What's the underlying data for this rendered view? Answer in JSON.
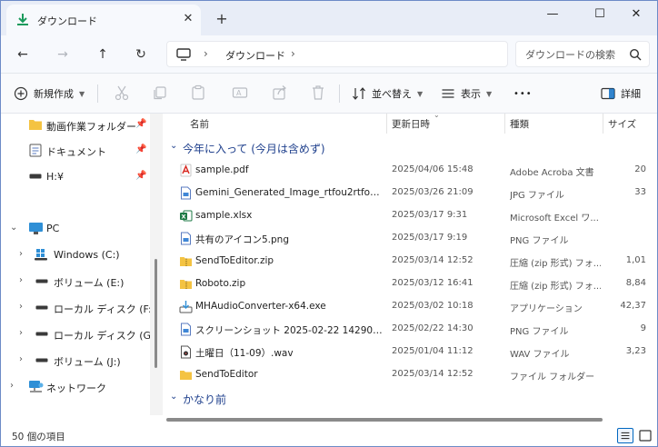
{
  "tab": {
    "title": "ダウンロード",
    "close": "✕",
    "new": "+"
  },
  "window_controls": {
    "minimize": "—",
    "maximize": "☐",
    "close": "✕"
  },
  "nav": {
    "back": "←",
    "forward": "→",
    "up": "↑",
    "refresh": "↻"
  },
  "address": {
    "crumb": "ダウンロード",
    "chevron": "›"
  },
  "search": {
    "placeholder": "ダウンロードの検索"
  },
  "commands": {
    "new_label": "新規作成",
    "sort_label": "並べ替え",
    "view_label": "表示",
    "more_label": "•••",
    "details_label": "詳細"
  },
  "sidebar": {
    "items": [
      {
        "label": "動画作業フォルダー",
        "icon": "folder-icon"
      },
      {
        "label": "ドキュメント",
        "icon": "document-icon"
      },
      {
        "label": "H:¥",
        "icon": "drive-icon"
      },
      {
        "label": "PC",
        "icon": "pc-icon"
      },
      {
        "label": "Windows (C:)",
        "icon": "windows-drive-icon"
      },
      {
        "label": "ボリューム (E:)",
        "icon": "drive-icon"
      },
      {
        "label": "ローカル ディスク (F:)",
        "icon": "drive-icon"
      },
      {
        "label": "ローカル ディスク (G:)",
        "icon": "drive-icon"
      },
      {
        "label": "ボリューム (J:)",
        "icon": "drive-icon"
      },
      {
        "label": "ネットワーク",
        "icon": "network-icon"
      }
    ],
    "pin": "📌"
  },
  "columns": {
    "name": "名前",
    "date": "更新日時",
    "type": "種類",
    "size": "サイズ"
  },
  "groups": {
    "this_year": "今年に入って (今月は含めず)",
    "long_ago": "かなり前"
  },
  "files": [
    {
      "name": "sample.pdf",
      "date": "2025/04/06 15:48",
      "type": "Adobe Acroba 文書",
      "size": "20",
      "icon": "pdf-icon"
    },
    {
      "name": "Gemini_Generated_Image_rtfou2rtfou2rtfou2...",
      "date": "2025/03/26 21:09",
      "type": "JPG ファイル",
      "size": "33",
      "icon": "image-file-icon"
    },
    {
      "name": "sample.xlsx",
      "date": "2025/03/17 9:31",
      "type": "Microsoft Excel ワ...",
      "size": "",
      "icon": "excel-icon"
    },
    {
      "name": "共有のアイコン5.png",
      "date": "2025/03/17 9:19",
      "type": "PNG ファイル",
      "size": "",
      "icon": "image-file-icon"
    },
    {
      "name": "SendToEditor.zip",
      "date": "2025/03/14 12:52",
      "type": "圧縮 (zip 形式) フォ...",
      "size": "1,01",
      "icon": "zip-icon"
    },
    {
      "name": "Roboto.zip",
      "date": "2025/03/12 16:41",
      "type": "圧縮 (zip 形式) フォ...",
      "size": "8,84",
      "icon": "zip-icon"
    },
    {
      "name": "MHAudioConverter-x64.exe",
      "date": "2025/03/02 10:18",
      "type": "アプリケーション",
      "size": "42,37",
      "icon": "installer-icon"
    },
    {
      "name": "スクリーンショット 2025-02-22 142902.png",
      "date": "2025/02/22 14:30",
      "type": "PNG ファイル",
      "size": "9",
      "icon": "image-file-icon"
    },
    {
      "name": "土曜日（11-09）.wav",
      "date": "2025/01/04 11:12",
      "type": "WAV ファイル",
      "size": "3,23",
      "icon": "audio-file-icon"
    },
    {
      "name": "SendToEditor",
      "date": "2025/03/14 12:52",
      "type": "ファイル フォルダー",
      "size": "",
      "icon": "folder-icon"
    }
  ],
  "status": {
    "count": "50 個の項目"
  },
  "colors": {
    "accent": "#0067c0",
    "group": "#1e3f8c",
    "folder": "#f4c342"
  }
}
